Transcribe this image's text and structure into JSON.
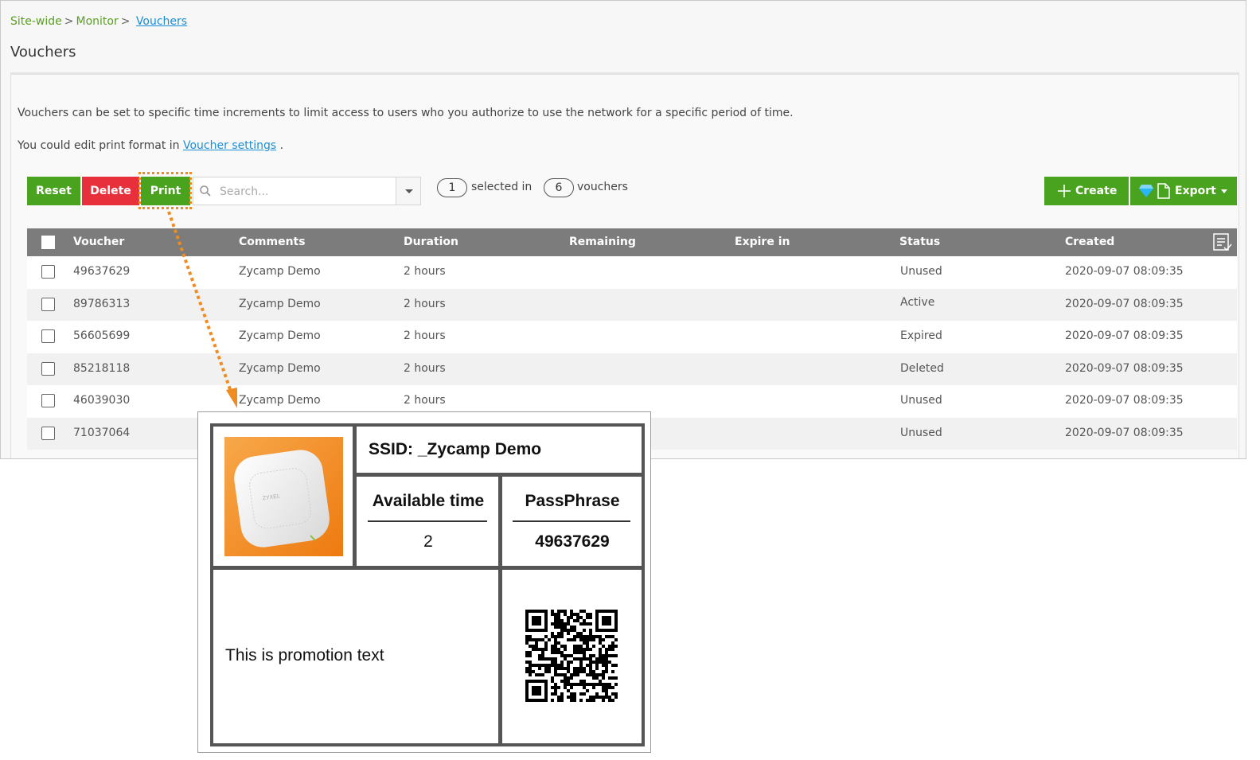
{
  "breadcrumb": {
    "item1": "Site-wide",
    "sep1": ">",
    "item2": "Monitor",
    "sep2": ">",
    "current": "Vouchers"
  },
  "page_title": "Vouchers",
  "description": {
    "line1": "Vouchers can be set to specific time increments to limit access to users who you authorize to use the network for a specific period of time.",
    "line2_prefix": "You could edit print format in",
    "line2_link": "Voucher settings",
    "line2_suffix": "."
  },
  "toolbar": {
    "reset_label": "Reset",
    "delete_label": "Delete",
    "print_label": "Print",
    "search_placeholder": "Search...",
    "selected_count": "1",
    "selected_in_text": "selected in",
    "total_count": "6",
    "vouchers_text": "vouchers",
    "create_label": "Create",
    "export_label": "Export"
  },
  "table": {
    "headers": [
      "Voucher",
      "Comments",
      "Duration",
      "Remaining",
      "Expire in",
      "Status",
      "Created"
    ],
    "rows": [
      {
        "voucher": "49637629",
        "comments": "Zycamp Demo",
        "duration": "2 hours",
        "status": "Unused",
        "created": "2020-09-07 08:09:35"
      },
      {
        "voucher": "89786313",
        "comments": "Zycamp Demo",
        "duration": "2 hours",
        "status": "Active",
        "created": "2020-09-07 08:09:35"
      },
      {
        "voucher": "56605699",
        "comments": "Zycamp Demo",
        "duration": "2 hours",
        "status": "Expired",
        "created": "2020-09-07 08:09:35"
      },
      {
        "voucher": "85218118",
        "comments": "Zycamp Demo",
        "duration": "2 hours",
        "status": "Deleted",
        "created": "2020-09-07 08:09:35"
      },
      {
        "voucher": "46039030",
        "comments": "Zycamp Demo",
        "duration": "2 hours",
        "status": "Unused",
        "created": "2020-09-07 08:09:35"
      },
      {
        "voucher": "71037064",
        "comments": "",
        "duration": "",
        "status": "Unused",
        "created": "2020-09-07 08:09:35"
      }
    ]
  },
  "voucher_card": {
    "ssid_line": "SSID: _Zycamp Demo",
    "available_time_label": "Available time",
    "available_time_value": "2",
    "passphrase_label": "PassPhrase",
    "passphrase_value": "49637629",
    "promotion_text": "This is promotion text",
    "product_brand": "ZYXEL"
  },
  "colors": {
    "green": "#4aa31f",
    "red": "#e8303d",
    "link": "#1a8fd6",
    "highlight": "#ef8b1f",
    "header": "#7c7c7c"
  },
  "icons": [
    "search-icon",
    "chevron-down-icon",
    "plus-icon",
    "gem-icon",
    "file-icon",
    "caret-down-icon",
    "column-settings-icon",
    "qr-code",
    "access-point-image"
  ]
}
